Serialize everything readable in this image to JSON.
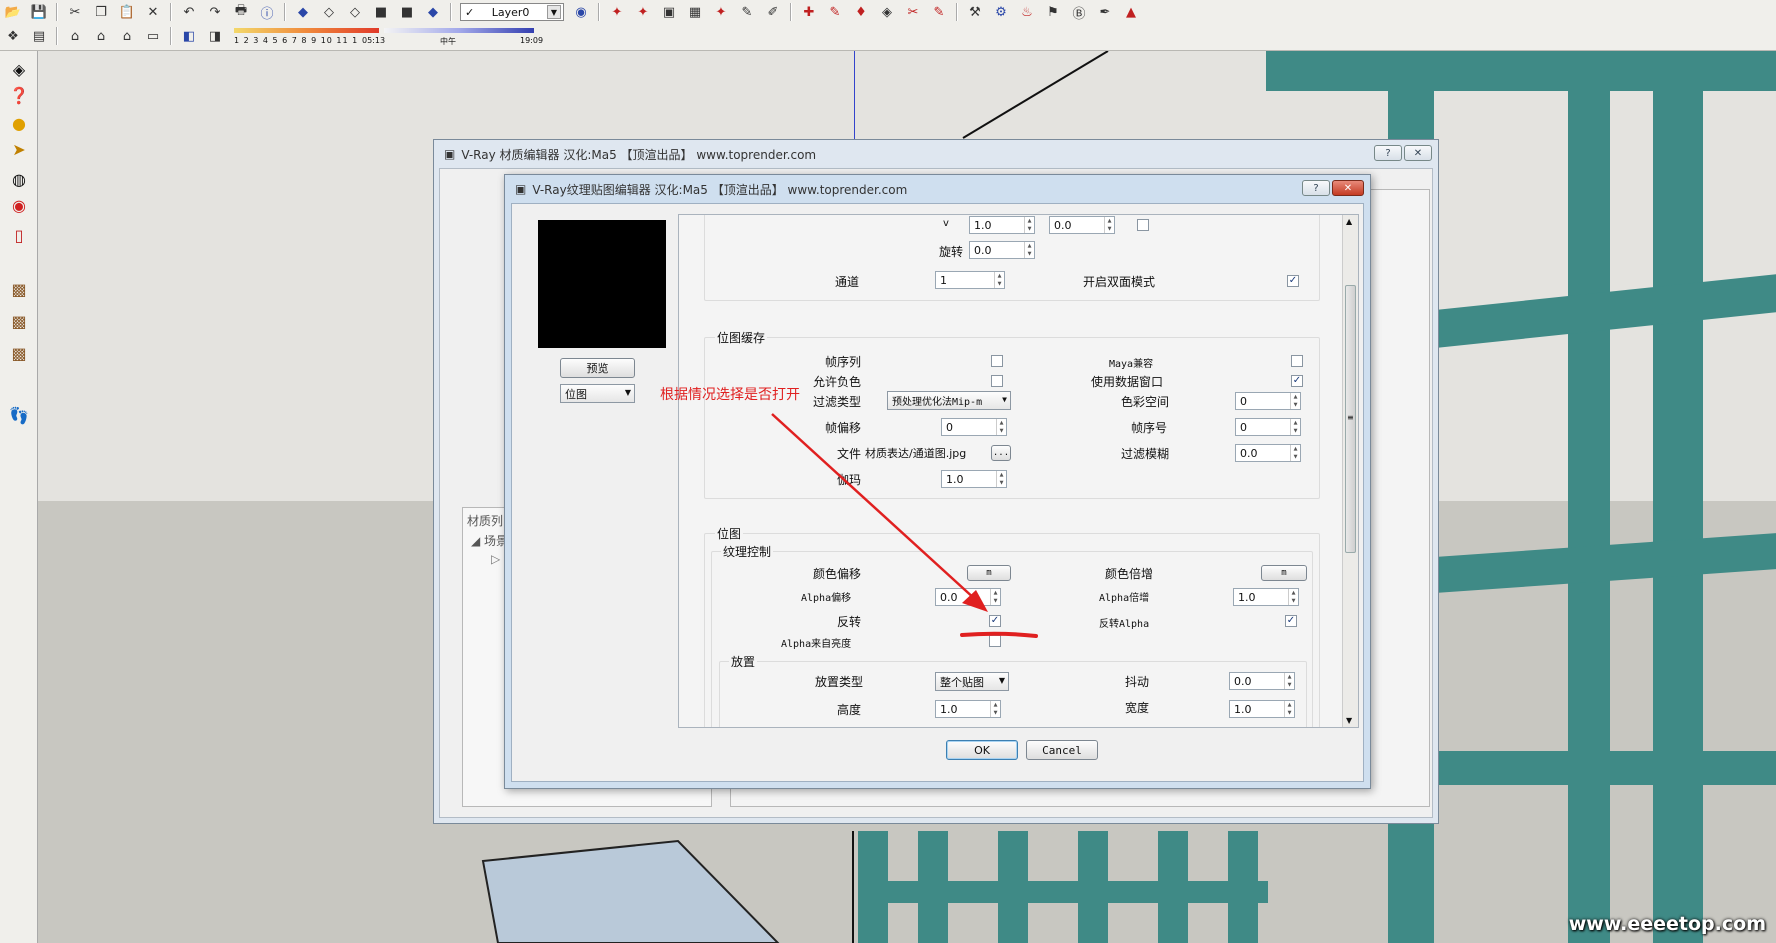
{
  "toolbar": {
    "layer_name": "Layer0",
    "shadow_months": "1  2  3  4  5  6  7  8  9  10 11 1",
    "shadow_time_start": "05:13",
    "shadow_noon": "中午",
    "shadow_time_end": "19:09"
  },
  "material_editor": {
    "title": "V-Ray 材质编辑器    汉化:Ma5    【顶渲出品】 www.toprender.com",
    "help_btn": "?",
    "close_btn": "✕",
    "tree_header": "材质列",
    "tree_item": "场景"
  },
  "texture_editor": {
    "title": "V-Ray纹理贴图编辑器    汉化:Ma5    【顶渲出品】 www.toprender.com",
    "help_btn": "?",
    "close_btn": "✕",
    "preview_button": "预览",
    "type_combo": "位图",
    "ok_button": "OK",
    "cancel_button": "Cancel",
    "uv": {
      "v_label": "v",
      "v_value": "1.0",
      "v_offset": "0.0",
      "rotate_label": "旋转",
      "rotate_value": "0.0",
      "channel_label": "通道",
      "channel_value": "1",
      "double_sided_label": "开启双面模式",
      "double_sided_checked": "✓"
    },
    "bitmap_cache": {
      "title": "位图缓存",
      "frame_seq_label": "帧序列",
      "maya_compat_label": "Maya兼容",
      "allow_negative_label": "允许负色",
      "use_data_window_label": "使用数据窗口",
      "use_data_window_checked": "✓",
      "filter_type_label": "过滤类型",
      "filter_type_value": "预处理优化法Mip-m",
      "color_space_label": "色彩空间",
      "color_space_value": "0",
      "frame_offset_label": "帧偏移",
      "frame_offset_value": "0",
      "frame_number_label": "帧序号",
      "frame_number_value": "0",
      "file_label": "文件",
      "file_value": "材质表达/通道图.jpg",
      "browse_btn": "...",
      "filter_blur_label": "过滤模糊",
      "filter_blur_value": "0.0",
      "gamma_label": "伽玛",
      "gamma_value": "1.0"
    },
    "bitmap": {
      "title": "位图",
      "texture_control_title": "纹理控制",
      "color_offset_label": "颜色偏移",
      "color_offset_btn": "m",
      "color_mult_label": "颜色倍增",
      "color_mult_btn": "m",
      "alpha_offset_label": "Alpha偏移",
      "alpha_offset_value": "0.0",
      "alpha_mult_label": "Alpha倍增",
      "alpha_mult_value": "1.0",
      "invert_label": "反转",
      "invert_checked": "✓",
      "invert_alpha_label": "反转Alpha",
      "invert_alpha_checked": "✓",
      "alpha_from_intensity_label": "Alpha来自亮度",
      "placement_title": "放置",
      "placement_type_label": "放置类型",
      "placement_type_value": "整个贴图",
      "jitter_label": "抖动",
      "jitter_value": "0.0",
      "height_label": "高度",
      "height_value": "1.0",
      "width_label": "宽度",
      "width_value": "1.0"
    }
  },
  "annotation": {
    "text": "根据情况选择是否打开",
    "color": "#e02020"
  },
  "watermark": "www.eeeetop.com"
}
